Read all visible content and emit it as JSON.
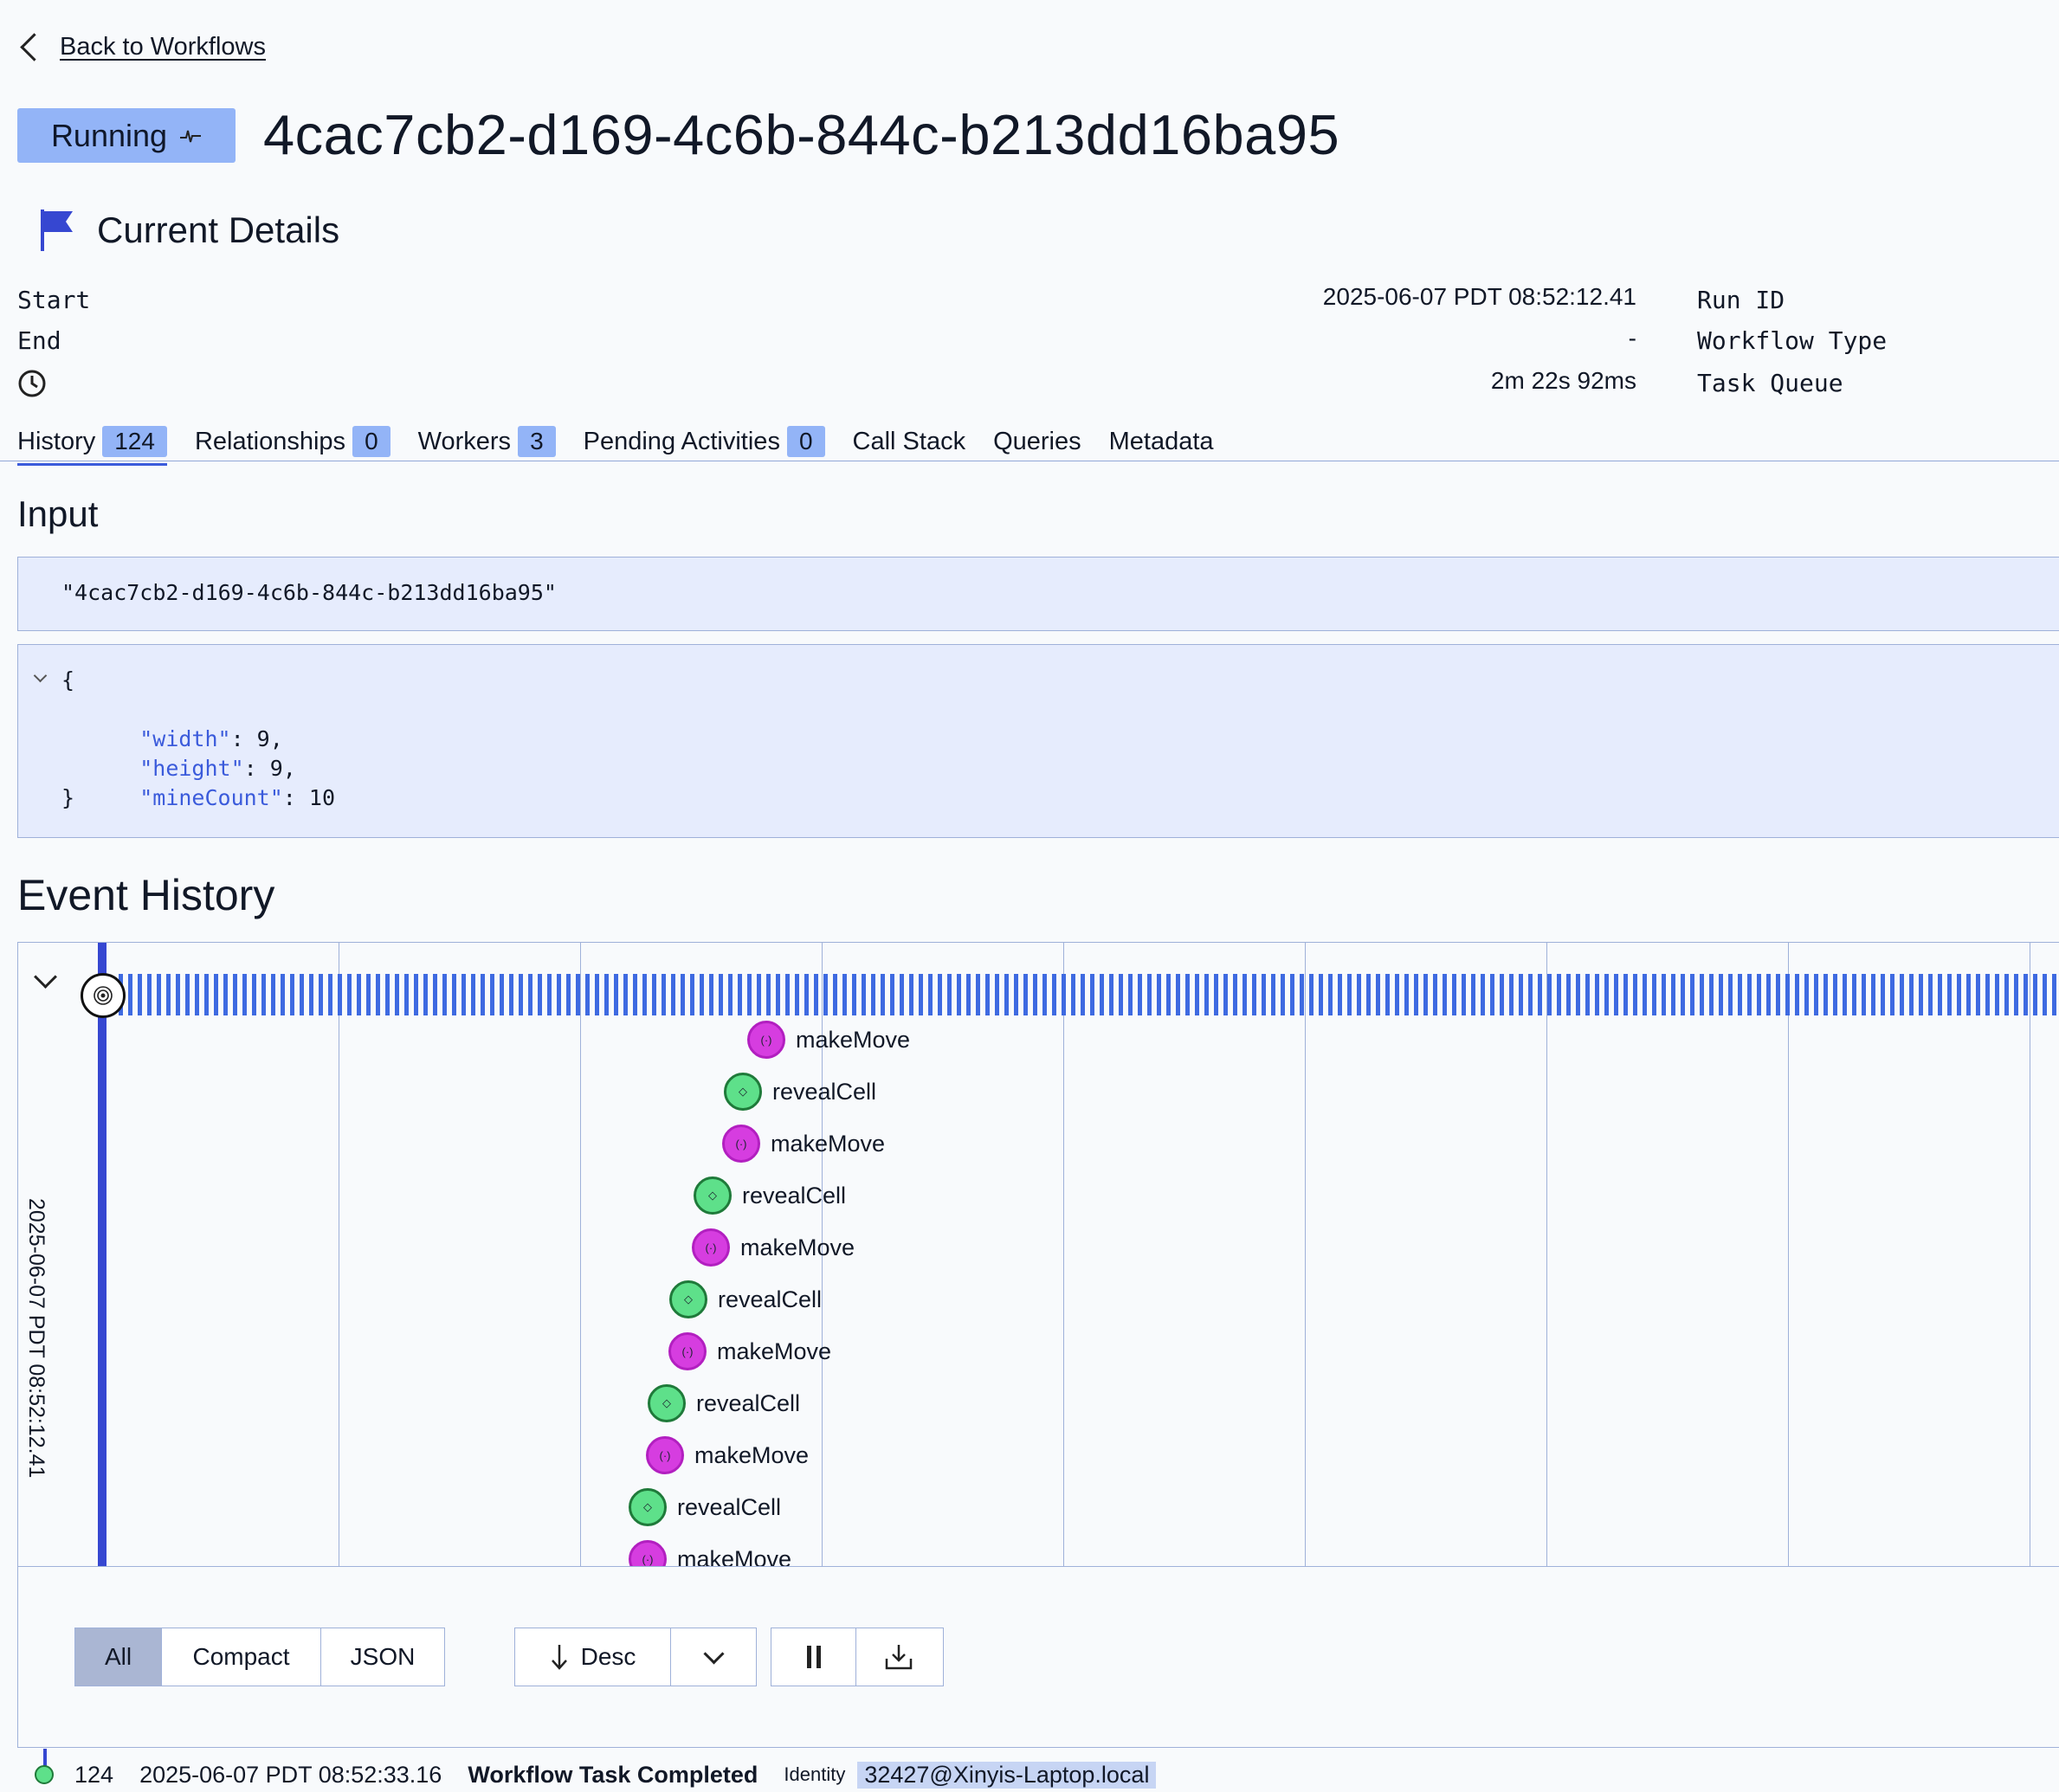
{
  "nav": {
    "back_label": "Back to Workflows"
  },
  "header": {
    "status": "Running",
    "workflow_id": "4cac7cb2-d169-4c6b-844c-b213dd16ba95",
    "section_title": "Current Details"
  },
  "summary": {
    "start_label": "Start",
    "start_value": "2025-06-07 PDT 08:52:12.41",
    "end_label": "End",
    "end_value": "-",
    "duration_value": "2m 22s 92ms",
    "run_id_label": "Run ID",
    "workflow_type_label": "Workflow Type",
    "task_queue_label": "Task Queue"
  },
  "tabs": [
    {
      "label": "History",
      "count": "124"
    },
    {
      "label": "Relationships",
      "count": "0"
    },
    {
      "label": "Workers",
      "count": "3"
    },
    {
      "label": "Pending Activities",
      "count": "0"
    },
    {
      "label": "Call Stack"
    },
    {
      "label": "Queries"
    },
    {
      "label": "Metadata"
    }
  ],
  "input": {
    "title": "Input",
    "arg1": "\"4cac7cb2-d169-4c6b-844c-b213dd16ba95\"",
    "json_open": "{",
    "json_close": "}",
    "fields": [
      {
        "key": "\"width\"",
        "value": ": 9,"
      },
      {
        "key": "\"height\"",
        "value": ": 9,"
      },
      {
        "key": "\"mineCount\"",
        "value": ": 10"
      }
    ]
  },
  "event_history": {
    "title": "Event History",
    "timeline_date": "2025-06-07 PDT 08:52:12.41",
    "events": [
      {
        "name": "makeMove",
        "type": "activity"
      },
      {
        "name": "revealCell",
        "type": "signal"
      },
      {
        "name": "makeMove",
        "type": "activity"
      },
      {
        "name": "revealCell",
        "type": "signal"
      },
      {
        "name": "makeMove",
        "type": "activity"
      },
      {
        "name": "revealCell",
        "type": "signal"
      },
      {
        "name": "makeMove",
        "type": "activity"
      },
      {
        "name": "revealCell",
        "type": "signal"
      },
      {
        "name": "makeMove",
        "type": "activity"
      },
      {
        "name": "revealCell",
        "type": "signal"
      },
      {
        "name": "makeMove",
        "type": "activity"
      }
    ]
  },
  "controls": {
    "view_all": "All",
    "view_compact": "Compact",
    "view_json": "JSON",
    "sort": "Desc"
  },
  "history_row": {
    "id": "124",
    "time": "2025-06-07 PDT 08:52:33.16",
    "event": "Workflow Task Completed",
    "identity_label": "Identity",
    "identity_value": "32427@Xinyis-Laptop.local"
  },
  "colors": {
    "accent": "#3647d1",
    "status_badge": "#93b4f7",
    "activity": "#d63de0",
    "signal": "#5ee08a"
  }
}
